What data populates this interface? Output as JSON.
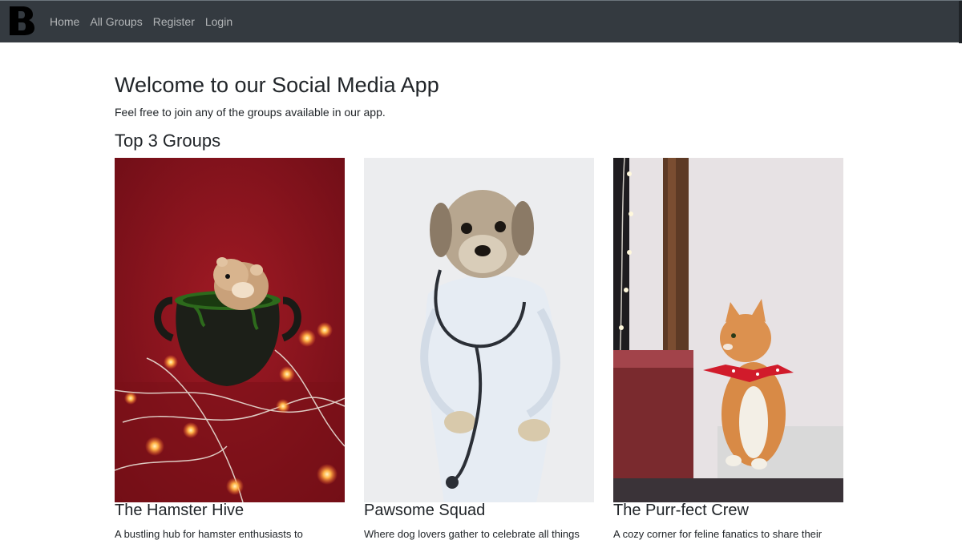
{
  "navbar": {
    "brand": "B",
    "links": [
      "Home",
      "All Groups",
      "Register",
      "Login"
    ]
  },
  "main": {
    "title": "Welcome to our Social Media App",
    "intro": "Feel free to join any of the groups available in our app.",
    "section_title": "Top 3 Groups",
    "groups": [
      {
        "name": "The Hamster Hive",
        "description": "A bustling hub for hamster enthusiasts to",
        "image": "hamster-in-pot-photo"
      },
      {
        "name": "Pawsome Squad",
        "description": "Where dog lovers gather to celebrate all things",
        "image": "dog-doctor-photo"
      },
      {
        "name": "The Purr-fect Crew",
        "description": "A cozy corner for feline fanatics to share their",
        "image": "cat-with-bandana-photo"
      }
    ]
  },
  "colors": {
    "navbar_bg": "#343a40",
    "nav_link": "rgba(255,255,255,0.62)",
    "text": "#212529"
  }
}
